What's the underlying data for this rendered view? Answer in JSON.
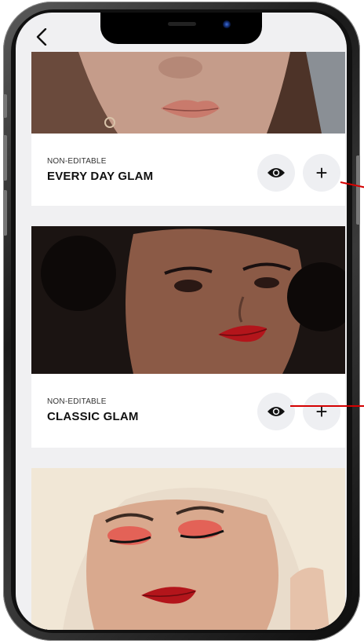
{
  "cards": [
    {
      "tag": "NON-EDITABLE",
      "title": "EVERY DAY GLAM",
      "view_icon": "eye-icon",
      "add_label": "+"
    },
    {
      "tag": "NON-EDITABLE",
      "title": "CLASSIC GLAM",
      "view_icon": "eye-icon",
      "add_label": "+"
    },
    {
      "tag": "",
      "title": ""
    }
  ],
  "colors": {
    "annotation": "#d40000",
    "button_bg": "#eeeff2",
    "lip_red": "#b3151b"
  }
}
